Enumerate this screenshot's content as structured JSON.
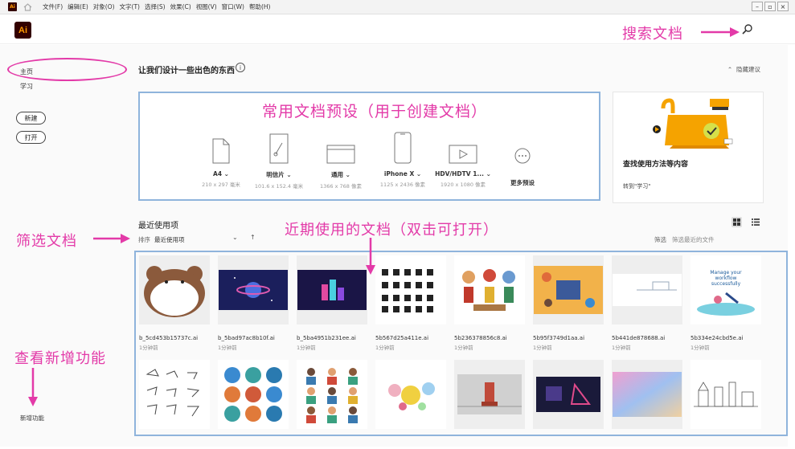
{
  "menubar": {
    "logo": "Ai",
    "items": [
      "文件(F)",
      "编辑(E)",
      "对象(O)",
      "文字(T)",
      "选择(S)",
      "效果(C)",
      "视图(V)",
      "窗口(W)",
      "帮助(H)"
    ],
    "controls": [
      "–",
      "▫",
      "×"
    ]
  },
  "header": {
    "logo": "Ai",
    "search_icon": "search-icon"
  },
  "sidebar": {
    "home": "主页",
    "learn": "学习",
    "new_button": "新建",
    "open_button": "打开",
    "new_features": "新增功能"
  },
  "main": {
    "suggest_title": "让我们设计一些出色的东西",
    "info": "i",
    "hide_suggest": "隐藏建议",
    "presets": [
      {
        "name": "A4",
        "size": "210 x 297 毫米",
        "icon": "document-icon"
      },
      {
        "name": "明信片",
        "size": "101.6 x 152.4 毫米",
        "icon": "postcard-icon"
      },
      {
        "name": "通用",
        "size": "1366 x 768 像素",
        "icon": "web-icon"
      },
      {
        "name": "iPhone X",
        "size": "1125 x 2436 像素",
        "icon": "phone-icon"
      },
      {
        "name": "HDV/HDTV 1...",
        "size": "1920 x 1080 像素",
        "icon": "video-icon"
      },
      {
        "name": "更多预设",
        "size": "",
        "icon": "more-icon"
      }
    ],
    "learn_card": {
      "title": "查找使用方法等内容",
      "link": "转到\"学习\""
    },
    "recent": {
      "title": "最近使用项",
      "sort_label": "排序",
      "sort_value": "最近使用项",
      "filter_label": "筛选",
      "filter_placeholder": "筛选最近的文件",
      "files": [
        {
          "name": "b_5cd453b15737c.ai",
          "time": "1分钟前"
        },
        {
          "name": "b_5bad97ac8b10f.ai",
          "time": "1分钟前"
        },
        {
          "name": "b_5ba4951b231ee.ai",
          "time": "1分钟前"
        },
        {
          "name": "5b567d25a411e.ai",
          "time": "1分钟前"
        },
        {
          "name": "5b236378856c8.ai",
          "time": "1分钟前"
        },
        {
          "name": "5b95f3749d1aa.ai",
          "time": "1分钟前"
        },
        {
          "name": "5b441de878688.ai",
          "time": "1分钟前"
        },
        {
          "name": "5b334e24cbd5e.ai",
          "time": "1分钟前"
        }
      ],
      "thumb_text": "Manage your workflow successfully"
    }
  },
  "annotations": {
    "search": "搜索文档",
    "presets": "常用文档预设（用于创建文档）",
    "filter": "筛选文档",
    "recent": "近期使用的文档（双击可打开）",
    "new_features": "查看新增功能"
  },
  "colors": {
    "accent": "#e33aa8",
    "highlight_box": "#8fb4dc",
    "ai_brand": "#ff9a00",
    "ai_bg": "#330000"
  }
}
